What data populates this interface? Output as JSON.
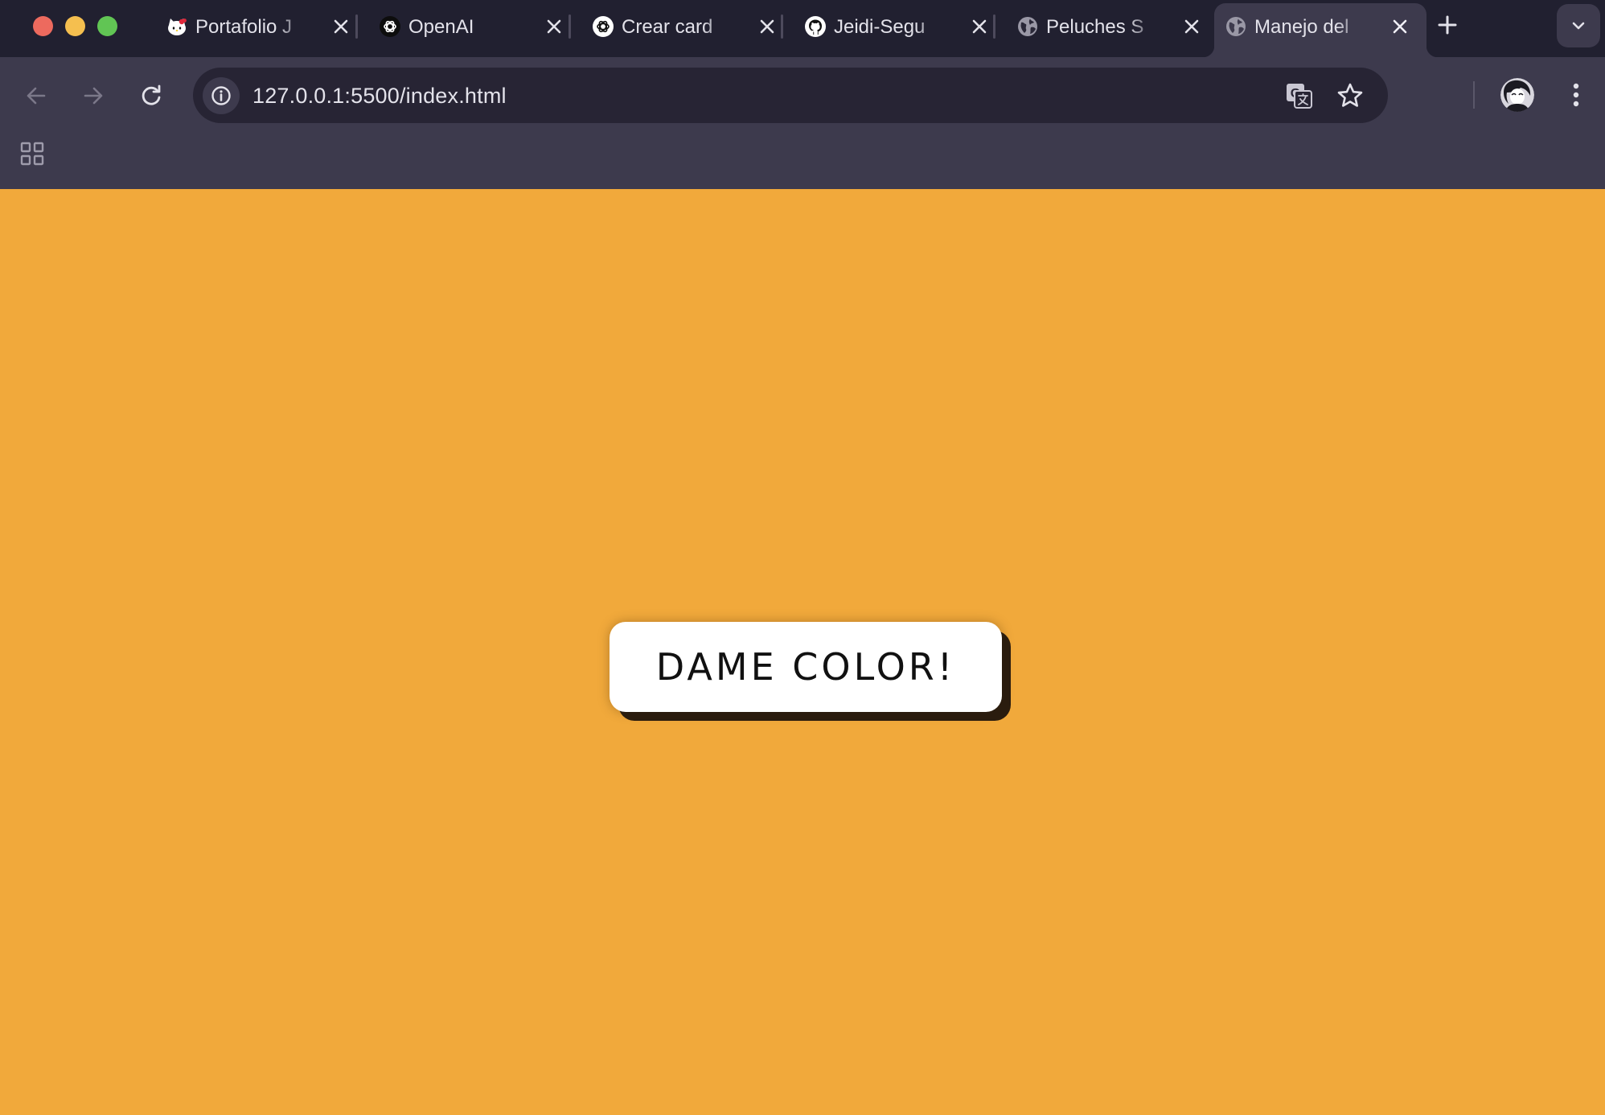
{
  "browser": {
    "tabs": [
      {
        "title": "Portafolio J",
        "icon": "hello-kitty-icon",
        "active": false
      },
      {
        "title": "OpenAI",
        "icon": "openai-icon",
        "active": false
      },
      {
        "title": "Crear card",
        "icon": "chatgpt-icon",
        "active": false
      },
      {
        "title": "Jeidi-Segu",
        "icon": "github-icon",
        "active": false
      },
      {
        "title": "Peluches S",
        "icon": "globe-icon",
        "active": false
      },
      {
        "title": "Manejo del",
        "icon": "globe-icon",
        "active": true
      }
    ],
    "address_bar": {
      "url": "127.0.0.1:5500/index.html"
    }
  },
  "page": {
    "background_color": "#f1a93b",
    "button_label": "DAME COLOR!"
  }
}
